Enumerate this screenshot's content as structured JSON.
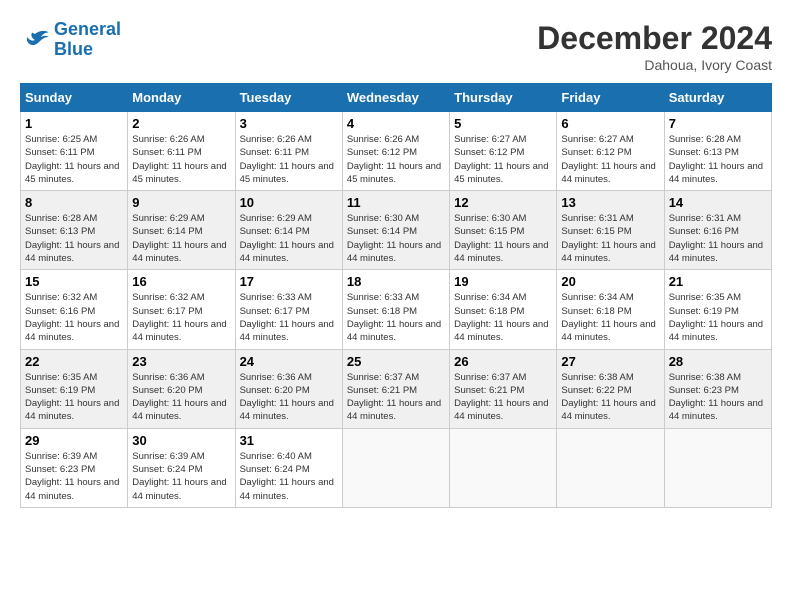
{
  "header": {
    "logo_line1": "General",
    "logo_line2": "Blue",
    "month_year": "December 2024",
    "location": "Dahoua, Ivory Coast"
  },
  "weekdays": [
    "Sunday",
    "Monday",
    "Tuesday",
    "Wednesday",
    "Thursday",
    "Friday",
    "Saturday"
  ],
  "weeks": [
    [
      {
        "day": "1",
        "sunrise": "6:25 AM",
        "sunset": "6:11 PM",
        "daylight": "11 hours and 45 minutes."
      },
      {
        "day": "2",
        "sunrise": "6:26 AM",
        "sunset": "6:11 PM",
        "daylight": "11 hours and 45 minutes."
      },
      {
        "day": "3",
        "sunrise": "6:26 AM",
        "sunset": "6:11 PM",
        "daylight": "11 hours and 45 minutes."
      },
      {
        "day": "4",
        "sunrise": "6:26 AM",
        "sunset": "6:12 PM",
        "daylight": "11 hours and 45 minutes."
      },
      {
        "day": "5",
        "sunrise": "6:27 AM",
        "sunset": "6:12 PM",
        "daylight": "11 hours and 45 minutes."
      },
      {
        "day": "6",
        "sunrise": "6:27 AM",
        "sunset": "6:12 PM",
        "daylight": "11 hours and 44 minutes."
      },
      {
        "day": "7",
        "sunrise": "6:28 AM",
        "sunset": "6:13 PM",
        "daylight": "11 hours and 44 minutes."
      }
    ],
    [
      {
        "day": "8",
        "sunrise": "6:28 AM",
        "sunset": "6:13 PM",
        "daylight": "11 hours and 44 minutes."
      },
      {
        "day": "9",
        "sunrise": "6:29 AM",
        "sunset": "6:14 PM",
        "daylight": "11 hours and 44 minutes."
      },
      {
        "day": "10",
        "sunrise": "6:29 AM",
        "sunset": "6:14 PM",
        "daylight": "11 hours and 44 minutes."
      },
      {
        "day": "11",
        "sunrise": "6:30 AM",
        "sunset": "6:14 PM",
        "daylight": "11 hours and 44 minutes."
      },
      {
        "day": "12",
        "sunrise": "6:30 AM",
        "sunset": "6:15 PM",
        "daylight": "11 hours and 44 minutes."
      },
      {
        "day": "13",
        "sunrise": "6:31 AM",
        "sunset": "6:15 PM",
        "daylight": "11 hours and 44 minutes."
      },
      {
        "day": "14",
        "sunrise": "6:31 AM",
        "sunset": "6:16 PM",
        "daylight": "11 hours and 44 minutes."
      }
    ],
    [
      {
        "day": "15",
        "sunrise": "6:32 AM",
        "sunset": "6:16 PM",
        "daylight": "11 hours and 44 minutes."
      },
      {
        "day": "16",
        "sunrise": "6:32 AM",
        "sunset": "6:17 PM",
        "daylight": "11 hours and 44 minutes."
      },
      {
        "day": "17",
        "sunrise": "6:33 AM",
        "sunset": "6:17 PM",
        "daylight": "11 hours and 44 minutes."
      },
      {
        "day": "18",
        "sunrise": "6:33 AM",
        "sunset": "6:18 PM",
        "daylight": "11 hours and 44 minutes."
      },
      {
        "day": "19",
        "sunrise": "6:34 AM",
        "sunset": "6:18 PM",
        "daylight": "11 hours and 44 minutes."
      },
      {
        "day": "20",
        "sunrise": "6:34 AM",
        "sunset": "6:18 PM",
        "daylight": "11 hours and 44 minutes."
      },
      {
        "day": "21",
        "sunrise": "6:35 AM",
        "sunset": "6:19 PM",
        "daylight": "11 hours and 44 minutes."
      }
    ],
    [
      {
        "day": "22",
        "sunrise": "6:35 AM",
        "sunset": "6:19 PM",
        "daylight": "11 hours and 44 minutes."
      },
      {
        "day": "23",
        "sunrise": "6:36 AM",
        "sunset": "6:20 PM",
        "daylight": "11 hours and 44 minutes."
      },
      {
        "day": "24",
        "sunrise": "6:36 AM",
        "sunset": "6:20 PM",
        "daylight": "11 hours and 44 minutes."
      },
      {
        "day": "25",
        "sunrise": "6:37 AM",
        "sunset": "6:21 PM",
        "daylight": "11 hours and 44 minutes."
      },
      {
        "day": "26",
        "sunrise": "6:37 AM",
        "sunset": "6:21 PM",
        "daylight": "11 hours and 44 minutes."
      },
      {
        "day": "27",
        "sunrise": "6:38 AM",
        "sunset": "6:22 PM",
        "daylight": "11 hours and 44 minutes."
      },
      {
        "day": "28",
        "sunrise": "6:38 AM",
        "sunset": "6:23 PM",
        "daylight": "11 hours and 44 minutes."
      }
    ],
    [
      {
        "day": "29",
        "sunrise": "6:39 AM",
        "sunset": "6:23 PM",
        "daylight": "11 hours and 44 minutes."
      },
      {
        "day": "30",
        "sunrise": "6:39 AM",
        "sunset": "6:24 PM",
        "daylight": "11 hours and 44 minutes."
      },
      {
        "day": "31",
        "sunrise": "6:40 AM",
        "sunset": "6:24 PM",
        "daylight": "11 hours and 44 minutes."
      },
      null,
      null,
      null,
      null
    ]
  ],
  "labels": {
    "sunrise": "Sunrise:",
    "sunset": "Sunset:",
    "daylight": "Daylight:"
  }
}
